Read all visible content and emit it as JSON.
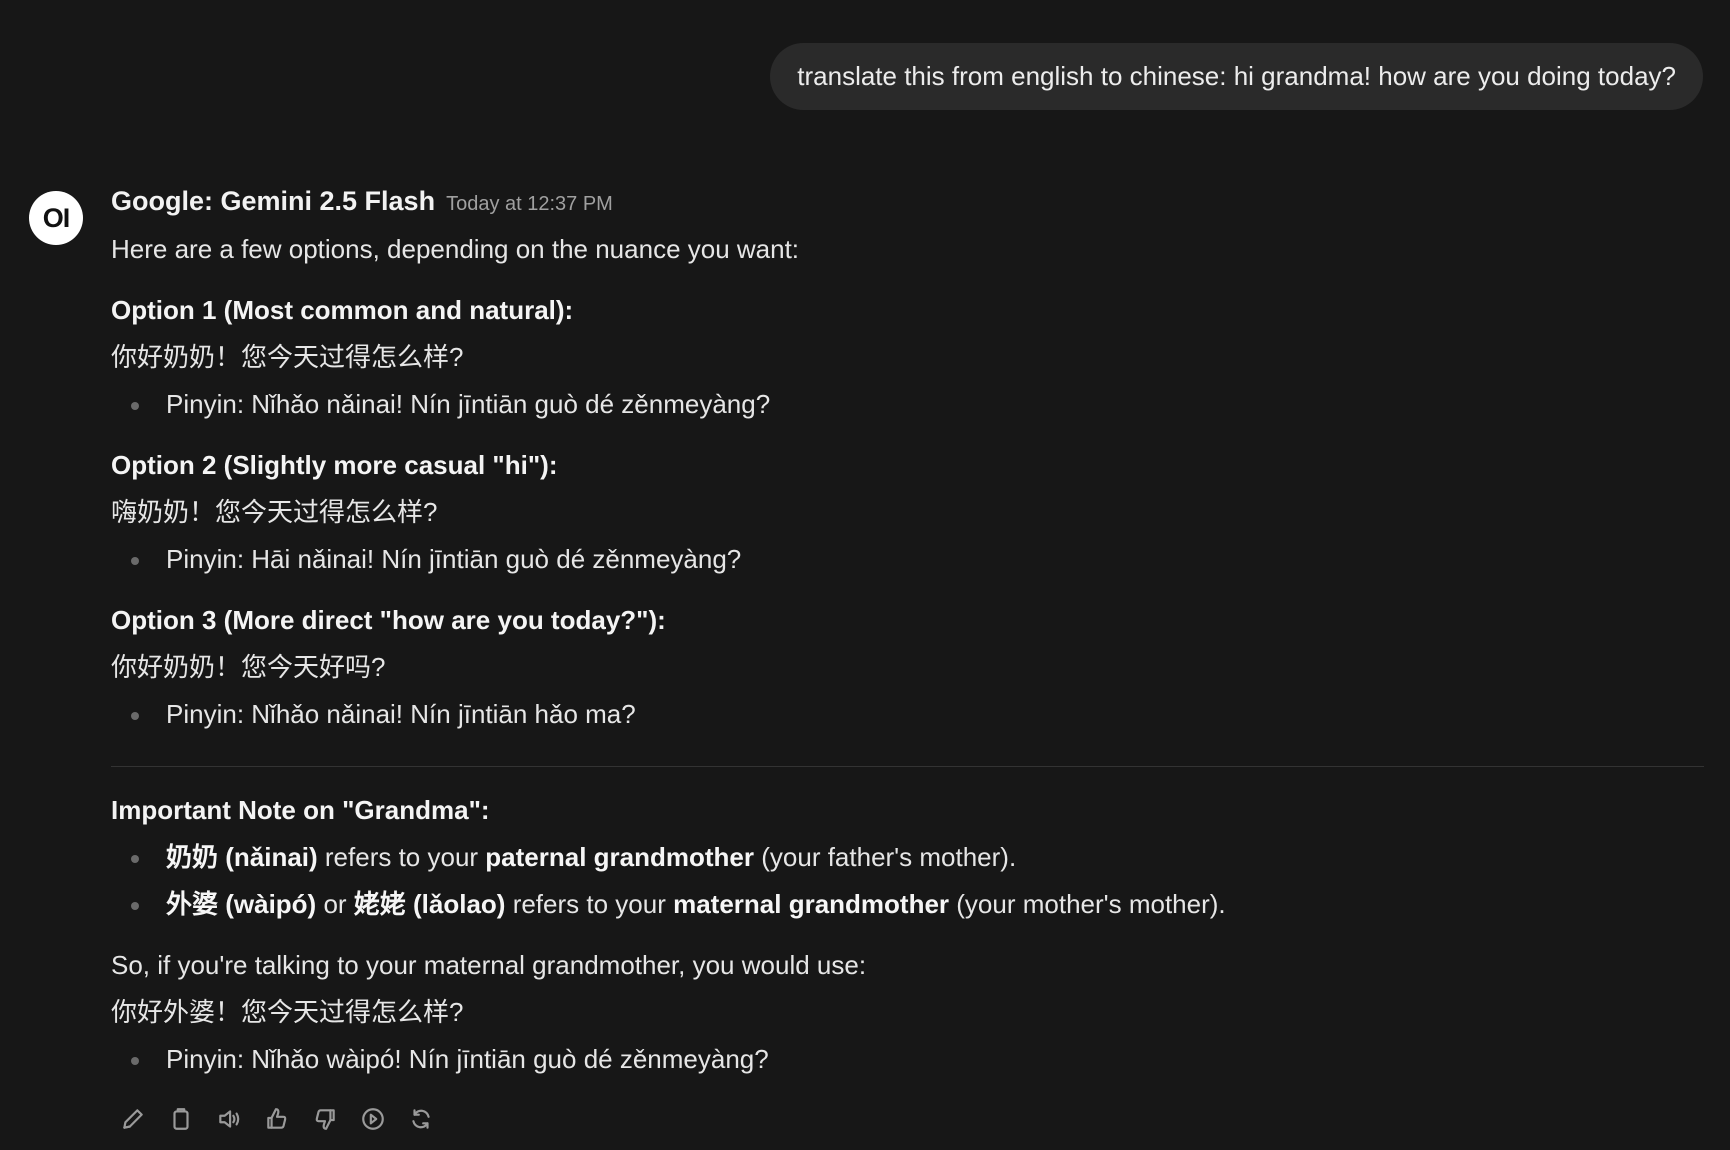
{
  "user_message": "translate this from english to chinese: hi grandma! how are you doing today?",
  "assistant": {
    "avatar_text": "OI",
    "model_name": "Google: Gemini 2.5 Flash",
    "timestamp": "Today at 12:37 PM",
    "intro": "Here are a few options, depending on the nuance you want:",
    "options": [
      {
        "title": "Option 1 (Most common and natural):",
        "chinese": "你好奶奶！您今天过得怎么样?",
        "pinyin": "Pinyin: Nǐhǎo nǎinai! Nín jīntiān guò dé zěnmeyàng?"
      },
      {
        "title": "Option 2 (Slightly more casual \"hi\"):",
        "chinese": "嗨奶奶！您今天过得怎么样?",
        "pinyin": "Pinyin: Hāi nǎinai! Nín jīntiān guò dé zěnmeyàng?"
      },
      {
        "title": "Option 3 (More direct \"how are you today?\"):",
        "chinese": "你好奶奶！您今天好吗?",
        "pinyin": "Pinyin: Nǐhǎo nǎinai! Nín jīntiān hǎo ma?"
      }
    ],
    "note": {
      "title": "Important Note on \"Grandma\":",
      "item1": {
        "term": "奶奶 (nǎinai)",
        "mid": " refers to your ",
        "strong": "paternal grandmother",
        "tail": " (your father's mother)."
      },
      "item2": {
        "term1": "外婆 (wàipó)",
        "or": " or ",
        "term2": "姥姥 (lǎolao)",
        "mid": " refers to your ",
        "strong": "maternal grandmother",
        "tail": " (your mother's mother)."
      }
    },
    "conclusion": "So, if you're talking to your maternal grandmother, you would use:",
    "final_chinese": "你好外婆！您今天过得怎么样?",
    "final_pinyin": "Pinyin: Nǐhǎo wàipó! Nín jīntiān guò dé zěnmeyàng?"
  },
  "toolbar_icons": [
    "edit-icon",
    "copy-icon",
    "read-aloud-icon",
    "thumbs-up-icon",
    "thumbs-down-icon",
    "continue-icon",
    "regenerate-icon"
  ]
}
